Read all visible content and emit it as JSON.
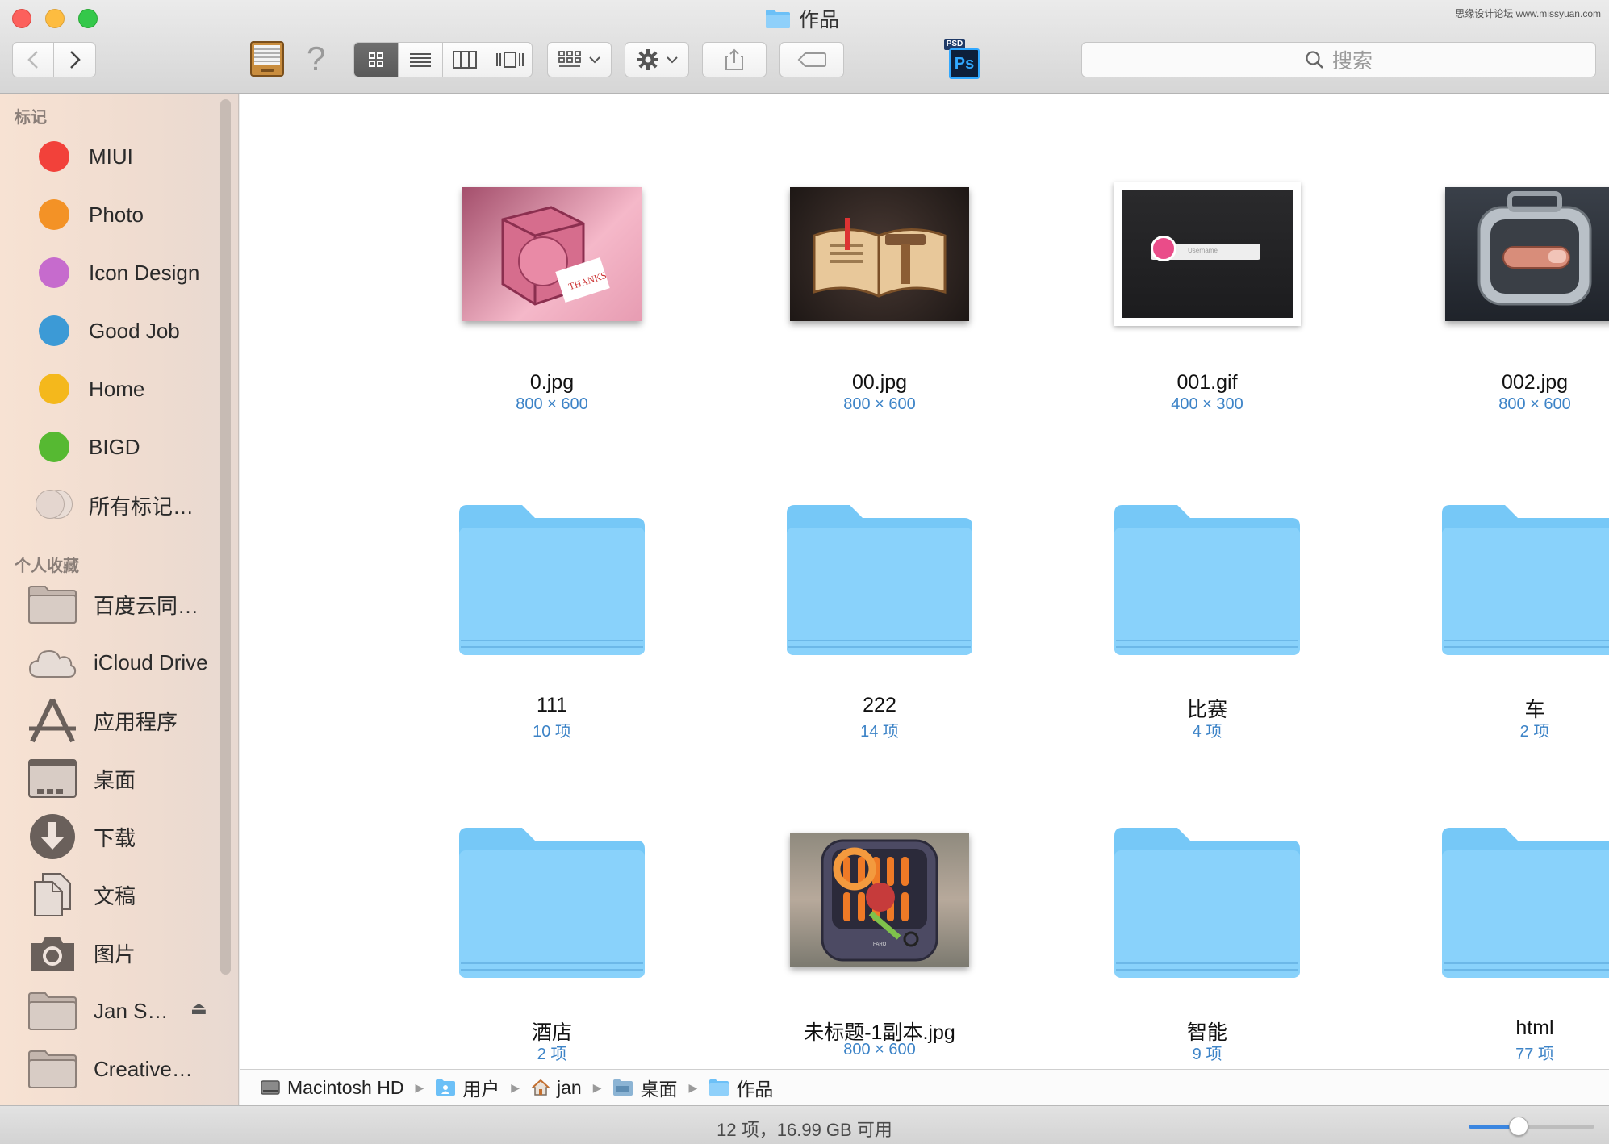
{
  "window": {
    "title": "作品",
    "watermark": "思缘设计论坛 www.missyuan.com"
  },
  "toolbar": {
    "search_placeholder": "搜索",
    "ps_badge_top": "PSD",
    "ps_badge_main": "Ps",
    "view_modes": [
      "icon-view",
      "list-view",
      "column-view",
      "coverflow-view"
    ],
    "active_view": "icon-view"
  },
  "sidebar": {
    "tags_heading": "标记",
    "tags": [
      {
        "label": "MIUI",
        "color": "#f2413a"
      },
      {
        "label": "Photo",
        "color": "#f39226"
      },
      {
        "label": "Icon Design",
        "color": "#c66bcd"
      },
      {
        "label": "Good Job",
        "color": "#3c9ad6"
      },
      {
        "label": "Home",
        "color": "#f4b81c"
      },
      {
        "label": "BIGD",
        "color": "#56b932"
      },
      {
        "label": "所有标记…",
        "color": "#e4d6cf"
      }
    ],
    "favorites_heading": "个人收藏",
    "favorites": [
      {
        "label": "百度云同…",
        "icon": "folder-icon"
      },
      {
        "label": "iCloud Drive",
        "icon": "cloud-icon"
      },
      {
        "label": "应用程序",
        "icon": "applications-icon"
      },
      {
        "label": "桌面",
        "icon": "desktop-icon"
      },
      {
        "label": "下载",
        "icon": "download-icon"
      },
      {
        "label": "文稿",
        "icon": "documents-icon"
      },
      {
        "label": "图片",
        "icon": "camera-icon"
      },
      {
        "label": "Jan S…",
        "icon": "folder-icon"
      },
      {
        "label": "Creative…",
        "icon": "folder-icon"
      }
    ]
  },
  "files": [
    {
      "name": "0.jpg",
      "meta": "800 × 600",
      "kind": "image",
      "thumb": "pink-box"
    },
    {
      "name": "00.jpg",
      "meta": "800 × 600",
      "kind": "image",
      "thumb": "book"
    },
    {
      "name": "001.gif",
      "meta": "400 × 300",
      "kind": "image",
      "thumb": "login"
    },
    {
      "name": "002.jpg",
      "meta": "800 × 600",
      "kind": "image",
      "thumb": "case"
    },
    {
      "name": "111",
      "meta": "10 项",
      "kind": "folder"
    },
    {
      "name": "222",
      "meta": "14 项",
      "kind": "folder"
    },
    {
      "name": "比赛",
      "meta": "4 项",
      "kind": "folder"
    },
    {
      "name": "车",
      "meta": "2 项",
      "kind": "folder"
    },
    {
      "name": "酒店",
      "meta": "2 项",
      "kind": "folder"
    },
    {
      "name": "未标题-1副本.jpg",
      "meta": "800 × 600",
      "kind": "image",
      "thumb": "grill"
    },
    {
      "name": "智能",
      "meta": "9 项",
      "kind": "folder"
    },
    {
      "name": "html",
      "meta": "77 项",
      "kind": "folder"
    }
  ],
  "thumb_login_field": "Username",
  "thumb_grill_label": "FARO",
  "thumb_thanks_label": "THANKS",
  "pathbar": [
    "Macintosh HD",
    "用户",
    "jan",
    "桌面",
    "作品"
  ],
  "status": {
    "text": "12 项，16.99 GB 可用",
    "zoom_fraction": 0.4
  }
}
